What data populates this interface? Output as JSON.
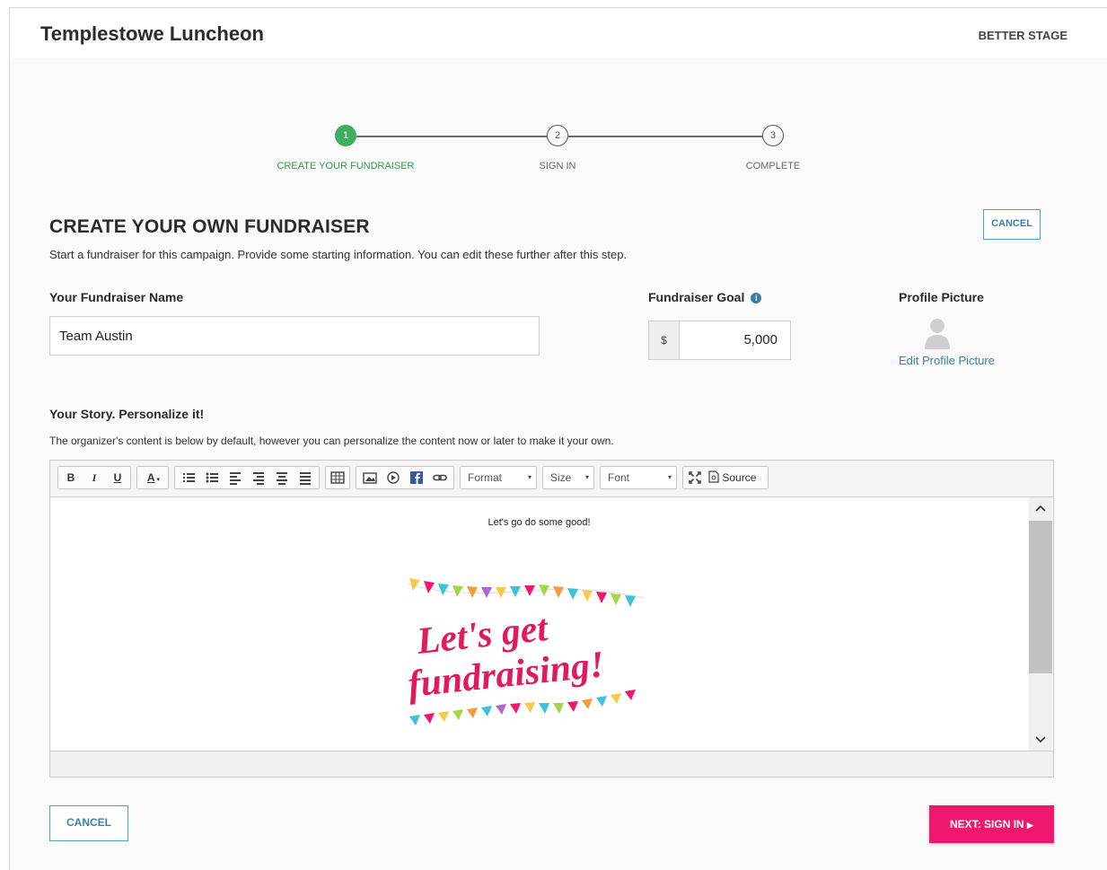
{
  "header": {
    "title": "Templestowe Luncheon",
    "org": "BETTER STAGE"
  },
  "stepper": {
    "steps": [
      {
        "number": "1",
        "label": "CREATE YOUR FUNDRAISER",
        "state": "active"
      },
      {
        "number": "2",
        "label": "SIGN IN",
        "state": "pending"
      },
      {
        "number": "3",
        "label": "COMPLETE",
        "state": "pending"
      }
    ]
  },
  "main": {
    "heading": "CREATE YOUR OWN FUNDRAISER",
    "subtext": "Start a fundraiser for this campaign. Provide some starting information. You can edit these further after this step.",
    "cancel_label": "CANCEL",
    "name_label": "Your Fundraiser Name",
    "name_value": "Team Austin",
    "goal_label": "Fundraiser Goal",
    "goal_currency": "$",
    "goal_value": "5,000",
    "profile_label": "Profile Picture",
    "edit_profile_label": "Edit Profile Picture",
    "story_title": "Your Story. Personalize it!",
    "story_desc": "The organizer's content is below by default, however you can personalize the content now or later to make it your own."
  },
  "editor": {
    "toolbar": {
      "bold": "B",
      "italic": "I",
      "underline": "U",
      "text_color": "A",
      "format": "Format",
      "size": "Size",
      "font": "Font",
      "source": "Source"
    },
    "content_text": "Let's go do some good!",
    "banner_line1": "Let's get",
    "banner_line2": "fundraising!",
    "banner_color": "#e2195f"
  },
  "footer": {
    "cancel_label": "CANCEL",
    "next_label": "NEXT: SIGN IN"
  },
  "colors": {
    "accent_green": "#3fae5f",
    "accent_blue": "#3a7fa8",
    "next_pink": "#f0186e"
  }
}
